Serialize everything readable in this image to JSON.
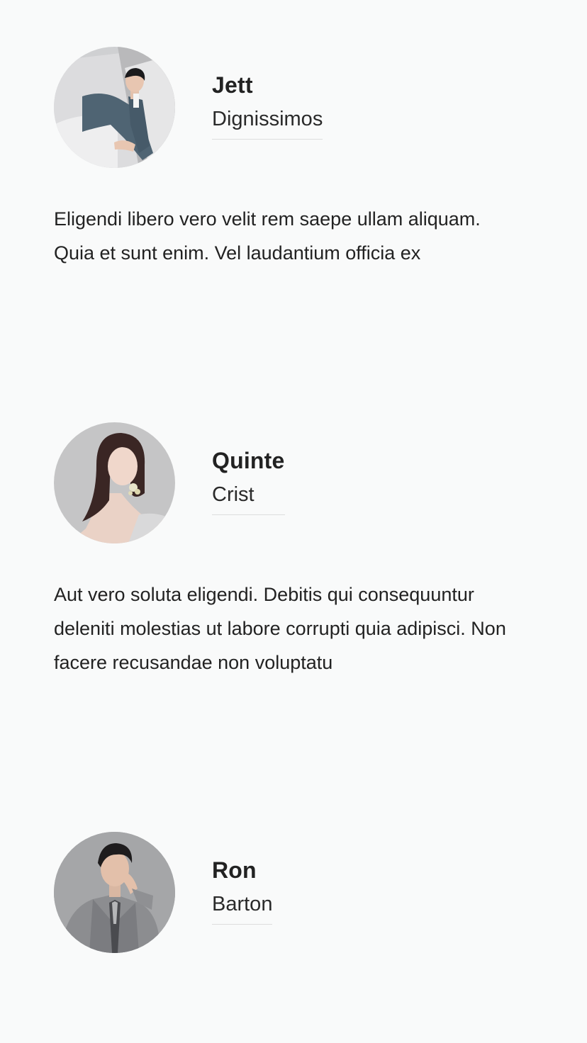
{
  "testimonials": [
    {
      "name": "Jett",
      "role": "Dignissimos",
      "text": "Eligendi libero vero velit rem saepe ullam aliquam. Quia et sunt enim. Vel laudantium officia ex",
      "avatar_icon": "person-photo-avatar"
    },
    {
      "name": "Quinte",
      "role": "Crist",
      "text": "Aut vero soluta eligendi. Debitis qui consequuntur deleniti molestias ut labore corrupti quia adipisci. Non facere recusandae non voluptatu",
      "avatar_icon": "person-photo-avatar"
    },
    {
      "name": "Ron",
      "role": "Barton",
      "text": "",
      "avatar_icon": "person-photo-avatar"
    }
  ],
  "colors": {
    "background": "#f9fafa",
    "text": "#222222",
    "divider": "#dddddd"
  }
}
